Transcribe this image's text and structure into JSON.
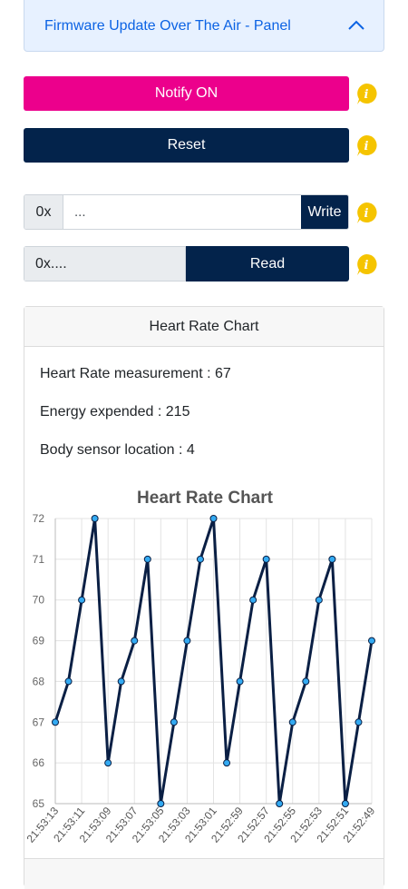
{
  "accordion": {
    "title": "Firmware Update Over The Air - Panel",
    "icon": "chevron-up-icon"
  },
  "buttons": {
    "notify": "Notify ON",
    "reset": "Reset"
  },
  "info_icon": {
    "name": "info-icon",
    "color": "#f5c400"
  },
  "write": {
    "prefix": "0x",
    "value": "...",
    "button": "Write"
  },
  "read": {
    "value": "0x....",
    "button": "Read"
  },
  "colors": {
    "notify": "#ec008c",
    "navy": "#03234b",
    "accent": "#0c63e4"
  },
  "card": {
    "header": "Heart Rate Chart",
    "measurements": [
      "Heart Rate measurement : 67",
      "Energy expended : 215",
      "Body sensor location : 4"
    ]
  },
  "chart_data": {
    "type": "line",
    "title": "Heart Rate Chart",
    "xlabel": "",
    "ylabel": "",
    "ylim": [
      65,
      72
    ],
    "yticks": [
      65,
      66,
      67,
      68,
      69,
      70,
      71,
      72
    ],
    "xtick_labels": [
      "21:53:13",
      "21:53:11",
      "21:53:09",
      "21:53:07",
      "21:53:05",
      "21:53:03",
      "21:53:01",
      "21:52:59",
      "21:52:57",
      "21:52:55",
      "21:52:53",
      "21:52:51",
      "21:52:49"
    ],
    "values": [
      67,
      68,
      70,
      72,
      66,
      68,
      69,
      71,
      65,
      67,
      69,
      71,
      72,
      66,
      68,
      70,
      71,
      65,
      67,
      68,
      70,
      71,
      65,
      67,
      69
    ],
    "grid": true,
    "line_color": "#0a1f44",
    "point_color": "#33aaf2"
  }
}
